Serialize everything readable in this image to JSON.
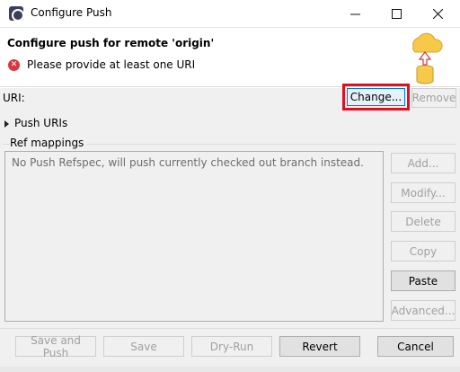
{
  "window": {
    "title": "Configure Push"
  },
  "header": {
    "title": "Configure push for remote 'origin'",
    "error": "Please provide at least one URI"
  },
  "uri": {
    "label": "URI:",
    "change": "Change...",
    "remove": "Remove"
  },
  "push_uris": {
    "label": "Push URIs"
  },
  "ref_mappings": {
    "label": "Ref mappings",
    "placeholder": "No Push Refspec, will push currently checked out branch instead."
  },
  "side_buttons": {
    "add": "Add...",
    "modify": "Modify...",
    "delete": "Delete",
    "copy": "Copy",
    "paste": "Paste",
    "advanced": "Advanced..."
  },
  "bottom_buttons": {
    "save_and_push": "Save and Push",
    "save": "Save",
    "dry_run": "Dry-Run",
    "revert": "Revert",
    "cancel": "Cancel"
  },
  "colors": {
    "error": "#d9363e",
    "highlight": "#e01020",
    "focus": "#0078d7"
  },
  "icons": [
    "eclipse-app-icon",
    "minimize-icon",
    "maximize-icon",
    "close-icon",
    "error-icon",
    "cloud-push-icon",
    "chevron-right-icon"
  ]
}
